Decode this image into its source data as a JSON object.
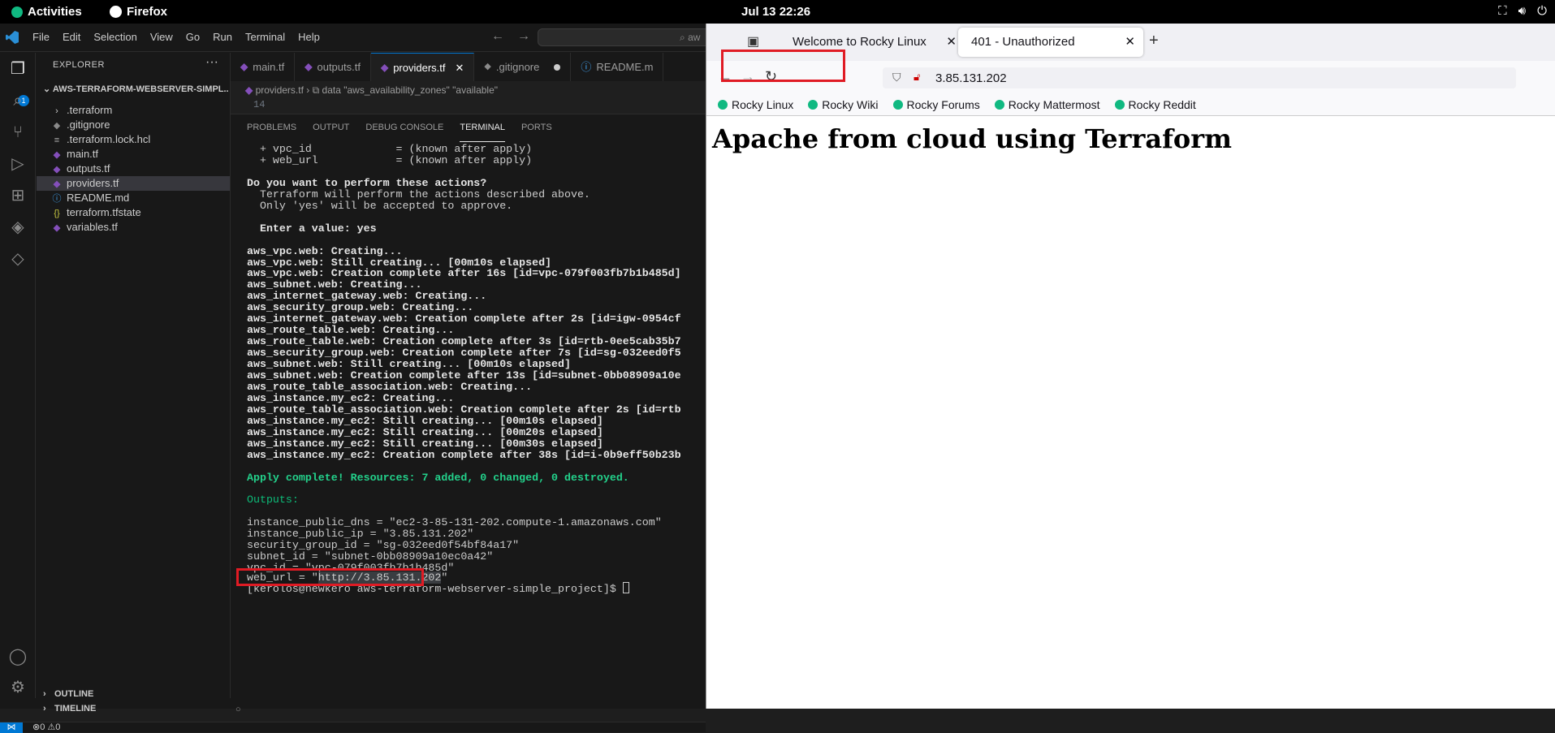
{
  "topbar": {
    "activities": "Activities",
    "app": "Firefox",
    "clock": "Jul 13  22:26"
  },
  "vscode": {
    "menu": [
      "File",
      "Edit",
      "Selection",
      "View",
      "Go",
      "Run",
      "Terminal",
      "Help"
    ],
    "search_text": "aw",
    "explorer": {
      "title": "EXPLORER",
      "folder": "AWS-TERRAFORM-WEBSERVER-SIMPL...",
      "files": [
        {
          "name": ".terraform",
          "icon": "chevron-right-icon"
        },
        {
          "name": ".gitignore",
          "icon": "gitignore-icon"
        },
        {
          "name": ".terraform.lock.hcl",
          "icon": "lines-icon"
        },
        {
          "name": "main.tf",
          "icon": "terraform-icon"
        },
        {
          "name": "outputs.tf",
          "icon": "terraform-icon"
        },
        {
          "name": "providers.tf",
          "icon": "terraform-icon",
          "selected": true
        },
        {
          "name": "README.md",
          "icon": "info-icon"
        },
        {
          "name": "terraform.tfstate",
          "icon": "braces-icon"
        },
        {
          "name": "variables.tf",
          "icon": "terraform-icon"
        }
      ],
      "outline": "OUTLINE",
      "timeline": "TIMELINE"
    },
    "tabs": [
      "main.tf",
      "outputs.tf",
      "providers.tf",
      ".gitignore",
      "README.m"
    ],
    "breadcrumb": {
      "file": "providers.tf",
      "symbol": "data \"aws_availability_zones\" \"available\""
    },
    "line_number": "14",
    "panel_tabs": [
      "PROBLEMS",
      "OUTPUT",
      "DEBUG CONSOLE",
      "TERMINAL",
      "PORTS"
    ],
    "terminal_lines": [
      {
        "t": "  + vpc_id             = (known after apply)",
        "s": ""
      },
      {
        "t": "  + web_url            = (known after apply)",
        "s": ""
      },
      {
        "t": "",
        "s": ""
      },
      {
        "t": "Do you want to perform these actions?",
        "s": "b"
      },
      {
        "t": "  Terraform will perform the actions described above.",
        "s": ""
      },
      {
        "t": "  Only 'yes' will be accepted to approve.",
        "s": ""
      },
      {
        "t": "",
        "s": ""
      },
      {
        "t": "  Enter a value: yes",
        "s": "b"
      },
      {
        "t": "",
        "s": ""
      },
      {
        "t": "aws_vpc.web: Creating...",
        "s": "b"
      },
      {
        "t": "aws_vpc.web: Still creating... [00m10s elapsed]",
        "s": "b"
      },
      {
        "t": "aws_vpc.web: Creation complete after 16s [id=vpc-079f003fb7b1b485d]",
        "s": "b"
      },
      {
        "t": "aws_subnet.web: Creating...",
        "s": "b"
      },
      {
        "t": "aws_internet_gateway.web: Creating...",
        "s": "b"
      },
      {
        "t": "aws_security_group.web: Creating...",
        "s": "b"
      },
      {
        "t": "aws_internet_gateway.web: Creation complete after 2s [id=igw-0954cf",
        "s": "b"
      },
      {
        "t": "aws_route_table.web: Creating...",
        "s": "b"
      },
      {
        "t": "aws_route_table.web: Creation complete after 3s [id=rtb-0ee5cab35b7",
        "s": "b"
      },
      {
        "t": "aws_security_group.web: Creation complete after 7s [id=sg-032eed0f5",
        "s": "b"
      },
      {
        "t": "aws_subnet.web: Still creating... [00m10s elapsed]",
        "s": "b"
      },
      {
        "t": "aws_subnet.web: Creation complete after 13s [id=subnet-0bb08909a10e",
        "s": "b"
      },
      {
        "t": "aws_route_table_association.web: Creating...",
        "s": "b"
      },
      {
        "t": "aws_instance.my_ec2: Creating...",
        "s": "b"
      },
      {
        "t": "aws_route_table_association.web: Creation complete after 2s [id=rtb",
        "s": "b"
      },
      {
        "t": "aws_instance.my_ec2: Still creating... [00m10s elapsed]",
        "s": "b"
      },
      {
        "t": "aws_instance.my_ec2: Still creating... [00m20s elapsed]",
        "s": "b"
      },
      {
        "t": "aws_instance.my_ec2: Still creating... [00m30s elapsed]",
        "s": "b"
      },
      {
        "t": "aws_instance.my_ec2: Creation complete after 38s [id=i-0b9eff50b23b",
        "s": "b"
      },
      {
        "t": "",
        "s": ""
      },
      {
        "t": "Apply complete! Resources: 7 added, 0 changed, 0 destroyed.",
        "s": "gb"
      },
      {
        "t": "",
        "s": ""
      },
      {
        "t": "Outputs:",
        "s": "g"
      },
      {
        "t": "",
        "s": ""
      },
      {
        "t": "instance_public_dns = \"ec2-3-85-131-202.compute-1.amazonaws.com\"",
        "s": ""
      },
      {
        "t": "instance_public_ip = \"3.85.131.202\"",
        "s": ""
      },
      {
        "t": "security_group_id = \"sg-032eed0f54bf84a17\"",
        "s": ""
      },
      {
        "t": "subnet_id = \"subnet-0bb08909a10ec0a42\"",
        "s": ""
      },
      {
        "t": "vpc_id = \"vpc-079f003fb7b1b485d\"",
        "s": ""
      }
    ],
    "web_url_prefix": "web_url = \"",
    "web_url_value": "http://3.85.131.202",
    "web_url_suffix": "\"",
    "prompt": "[kerolos@newkero aws-terraform-webserver-simple_project]$ ",
    "status_problems": "0",
    "status_warnings": "0"
  },
  "firefox": {
    "tabs": [
      "Welcome to Rocky Linux",
      "401 - Unauthorized"
    ],
    "url": "3.85.131.202",
    "bookmarks": [
      "Rocky Linux",
      "Rocky Wiki",
      "Rocky Forums",
      "Rocky Mattermost",
      "Rocky Reddit"
    ],
    "heading": "Apache from cloud using Terraform"
  }
}
